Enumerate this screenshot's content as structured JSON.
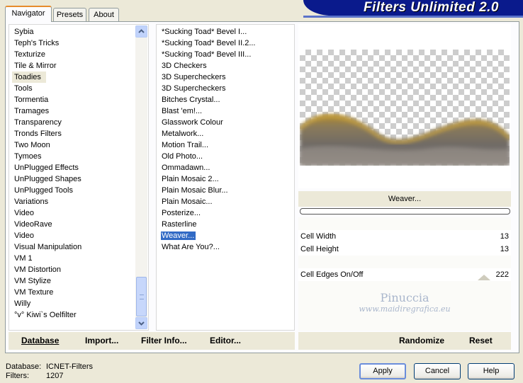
{
  "app": {
    "title": "Filters Unlimited 2.0"
  },
  "tabs": [
    {
      "label": "Navigator",
      "active": true
    },
    {
      "label": "Presets",
      "active": false
    },
    {
      "label": "About",
      "active": false
    }
  ],
  "categories": {
    "selected": "Toadies",
    "items": [
      "Sybia",
      "Teph's Tricks",
      "Texturize",
      "Tile & Mirror",
      "Toadies",
      "Tools",
      "Tormentia",
      "Tramages",
      "Transparency",
      "Tronds Filters",
      "Two Moon",
      "Tymoes",
      "UnPlugged Effects",
      "UnPlugged Shapes",
      "UnPlugged Tools",
      "Variations",
      "Video",
      "VideoRave",
      "Vidеo",
      "Visual Manipulation",
      "VM 1",
      "VM Distortion",
      "VM Stylize",
      "VM Texture",
      "Willy",
      "°v° Kiwi`s Oelfilter"
    ]
  },
  "filters": {
    "selected": "Weaver...",
    "items": [
      "*Sucking Toad*  Bevel I...",
      "*Sucking Toad*  Bevel II.2...",
      "*Sucking Toad*  Bevel III...",
      "3D Checkers",
      "3D Supercheckers",
      "3D Supercheckers",
      "Bitches Crystal...",
      "Blast 'em!...",
      "Glasswork Colour",
      "Metalwork...",
      "Motion Trail...",
      "Old Photo...",
      "Ommadawn...",
      "Plain Mosaic 2...",
      "Plain Mosaic Blur...",
      "Plain Mosaic...",
      "Posterize...",
      "Rasterline",
      "Weaver...",
      "What Are You?..."
    ]
  },
  "preview": {
    "filter_name": "Weaver..."
  },
  "params": [
    {
      "label": "Cell Width",
      "value": "13"
    },
    {
      "label": "Cell Height",
      "value": "13"
    },
    {
      "label": "Cell Edges On/Off",
      "value": "222"
    }
  ],
  "watermark": {
    "line1": "Pinuccia",
    "line2": "www.maidiregrafica.eu"
  },
  "buttons": {
    "database": "Database",
    "import": "Import...",
    "filter_info": "Filter Info...",
    "editor": "Editor...",
    "randomize": "Randomize",
    "reset": "Reset",
    "apply": "Apply",
    "cancel": "Cancel",
    "help": "Help"
  },
  "footer": {
    "database_label": "Database:",
    "database_value": "ICNET-Filters",
    "filters_label": "Filters:",
    "filters_value": "1207"
  },
  "colors": {
    "banner": "#0a1a8c",
    "selection": "#316ac5",
    "face": "#ece9d8"
  }
}
